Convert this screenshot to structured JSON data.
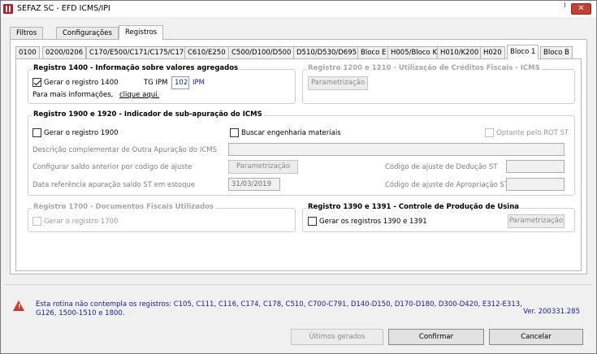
{
  "window": {
    "title": "SEFAZ SC - EFD ICMS/IPI",
    "close": "✕"
  },
  "main_tabs": [
    "Filtros",
    "Configurações",
    "Registros"
  ],
  "reg_tabs": [
    "0100",
    "0200/0206",
    "C170/E500/C171/C175/C176",
    "C610/E250",
    "C500/D100/D500",
    "D510/D530/D695",
    "Bloco E",
    "H005/Bloco K",
    "H010/K200",
    "H020",
    "Bloco 1",
    "Bloco B"
  ],
  "grp1400": {
    "title": "Registro 1400 - Informação sobre valores agregados",
    "checkbox_label": "Gerar o registro 1400",
    "checked": true,
    "tg_label": "TG IPM",
    "tg_value": "102",
    "tg_desc": "IPM",
    "info_text": "Para mais informações,",
    "info_link": "clique aqui."
  },
  "grp1200": {
    "title": "Registro 1200 e 1210 - Utilização de Créditos Fiscais - ICMS",
    "button": "Parametrização"
  },
  "grp1900": {
    "title": "Registro 1900 e 1920 - Indicador de sub-apuração do ICMS",
    "gerar_label": "Gerar o registro 1900",
    "buscar_label": "Buscar engenharia materiais",
    "optante_label": "Optante pelo ROT ST",
    "descricao_label": "Descrição complementar de Outra Apuração do ICMS",
    "configurar_label": "Configurar saldo anterior por codigo de ajuste",
    "configurar_button": "Parametrização",
    "data_label": "Data referência apuração saldo ST em estoque",
    "data_value": "31/03/2019",
    "deducao_label": "Código de ajuste de Dedução ST",
    "apropriacao_label": "Código de ajuste de Apropriação ST"
  },
  "grp1700": {
    "title": "Registro 1700 - Documentos Fiscais Utilizados",
    "checkbox_label": "Gerar o registro 1700"
  },
  "grp1390": {
    "title": "Registro 1390 e 1391 - Controle de Produção de Usina",
    "checkbox_label": "Gerar os registros 1390 e 1391",
    "button": "Parametrização"
  },
  "footer": {
    "warning_icon": "warning-triangle-icon",
    "note": "Esta rotina não contempla os registros: C105, C111, C116, C174, C178, C510, C700-C791, D140-D150, D170-D180, D300-D420, E312-E313, G126, 1500-1510 e 1800.",
    "version": "Ver. 200331.285",
    "ultimos_button": "Últimos gerados",
    "confirmar_button": "Confirmar",
    "cancelar_button": "Cancelar"
  },
  "colors": {
    "accent_blue": "#1a1a9a",
    "close_red": "#c7402f",
    "warning_red": "#d03a2b"
  }
}
